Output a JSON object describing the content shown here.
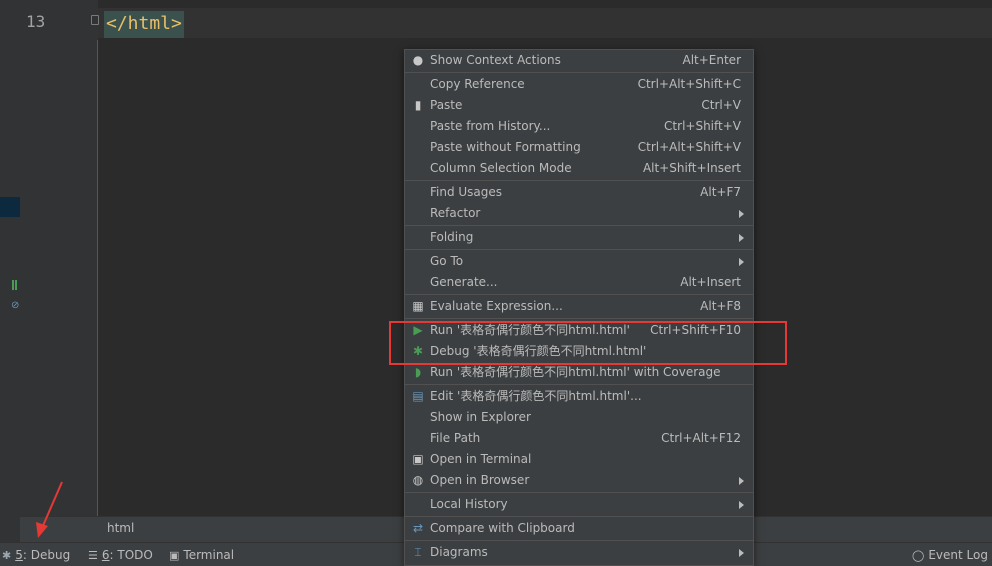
{
  "editor": {
    "line_number": "13",
    "code": "</html>",
    "breadcrumb": "html"
  },
  "colors": {
    "editor_bg": "#2b2b2b",
    "gutter_bg": "#313335",
    "menu_bg": "#3c3f41",
    "tag_color": "#e8bf6a",
    "run_green": "#499c54",
    "annotation_red": "#e53935"
  },
  "context_menu": {
    "items": [
      {
        "label": "Show Context Actions",
        "shortcut": "Alt+Enter",
        "icon": "lightbulb-icon"
      },
      {
        "label": "Copy Reference",
        "shortcut": "Ctrl+Alt+Shift+C"
      },
      {
        "label": "Paste",
        "shortcut": "Ctrl+V",
        "icon": "clipboard-icon"
      },
      {
        "label": "Paste from History...",
        "shortcut": "Ctrl+Shift+V"
      },
      {
        "label": "Paste without Formatting",
        "shortcut": "Ctrl+Alt+Shift+V"
      },
      {
        "label": "Column Selection Mode",
        "shortcut": "Alt+Shift+Insert"
      },
      {
        "label": "Find Usages",
        "shortcut": "Alt+F7"
      },
      {
        "label": "Refactor",
        "shortcut": "",
        "submenu": true
      },
      {
        "label": "Folding",
        "shortcut": "",
        "submenu": true
      },
      {
        "label": "Go To",
        "shortcut": "",
        "submenu": true
      },
      {
        "label": "Generate...",
        "shortcut": "Alt+Insert"
      },
      {
        "label": "Evaluate Expression...",
        "shortcut": "Alt+F8",
        "icon": "calculator-icon"
      },
      {
        "label": "Run '表格奇偶行颜色不同html.html'",
        "shortcut": "Ctrl+Shift+F10",
        "icon": "run-icon"
      },
      {
        "label": "Debug '表格奇偶行颜色不同html.html'",
        "shortcut": "",
        "icon": "debug-icon"
      },
      {
        "label": "Run '表格奇偶行颜色不同html.html' with Coverage",
        "shortcut": "",
        "icon": "coverage-icon"
      },
      {
        "label": "Edit '表格奇偶行颜色不同html.html'...",
        "shortcut": "",
        "icon": "edit-config-icon"
      },
      {
        "label": "Show in Explorer",
        "shortcut": ""
      },
      {
        "label": "File Path",
        "shortcut": "Ctrl+Alt+F12"
      },
      {
        "label": "Open in Terminal",
        "shortcut": "",
        "icon": "terminal-icon"
      },
      {
        "label": "Open in Browser",
        "shortcut": "",
        "submenu": true,
        "icon": "globe-icon"
      },
      {
        "label": "Local History",
        "shortcut": "",
        "submenu": true
      },
      {
        "label": "Compare with Clipboard",
        "shortcut": "",
        "icon": "compare-icon"
      },
      {
        "label": "Diagrams",
        "shortcut": "",
        "submenu": true,
        "icon": "diagram-icon"
      }
    ]
  },
  "status_bar": {
    "debug": {
      "num": "5",
      "text": ": Debug"
    },
    "todo": {
      "num": "6",
      "text": ": TODO"
    },
    "terminal": "Terminal",
    "event_log": "Event Log"
  }
}
